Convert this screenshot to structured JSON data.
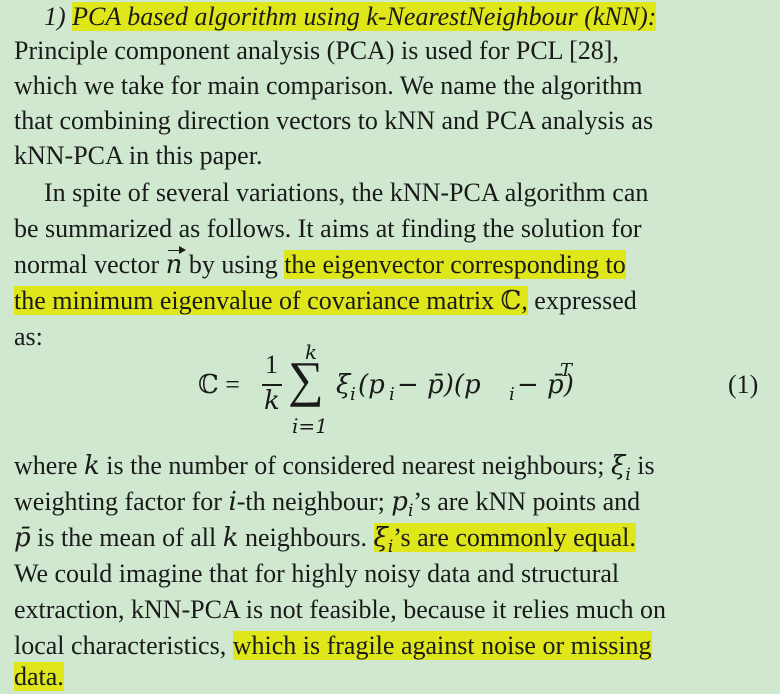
{
  "section": {
    "number": "1)",
    "title": "PCA based algorithm using k-NearestNeighbour (kNN):"
  },
  "p1": {
    "l1": "Principle component analysis (PCA) is used for PCL [28],",
    "l2": "which we take for main comparison. We name the algorithm",
    "l3": "that combining direction vectors to kNN and PCA analysis as",
    "l4": "kNN-PCA in this paper."
  },
  "p2": {
    "l1": "In spite of several variations, the kNN-PCA algorithm can",
    "l2": "be summarized as follows. It aims at finding the solution for",
    "l3a": "normal vector",
    "l3b": "by using",
    "l3c": "the eigenvector corresponding to",
    "l4a": "the minimum eigenvalue of covariance matrix ℂ,",
    "l4b": "expressed",
    "l5": "as:"
  },
  "equation": {
    "lhs": "ℂ =",
    "num": "1",
    "den": "k",
    "sum_upper": "k",
    "sum_lower": "i=1",
    "sigma": "∑",
    "body": "ξ",
    "body2": "(p",
    "body3": " − p̄)(p",
    "body4": " − p̄)",
    "sup": "T",
    "sub_i": "i",
    "number": "(1)"
  },
  "p3": {
    "l1a": "where",
    "l1b": "is the number of considered nearest neighbours;",
    "l1c": "is",
    "l2a": "weighting factor for",
    "l2b": "-th neighbour;",
    "l2c": "’s are kNN points and",
    "l3a": "is the mean of all",
    "l3b": "neighbours.",
    "l3c": "’s are commonly equal.",
    "l4": "We could imagine that for highly noisy data and structural",
    "l5": "extraction, kNN-PCA is not feasible, because it relies much on",
    "l6a": "local characteristics,",
    "l6b": "which is fragile against noise or missing",
    "l7": "data."
  },
  "symbols": {
    "k": "k",
    "i": "i",
    "xi": "ξ",
    "p": "p",
    "pbar": "p̄",
    "n": "n"
  },
  "colors": {
    "background": "#cfe8cf",
    "highlight": "#dfe619",
    "text": "#1a1a1a"
  }
}
